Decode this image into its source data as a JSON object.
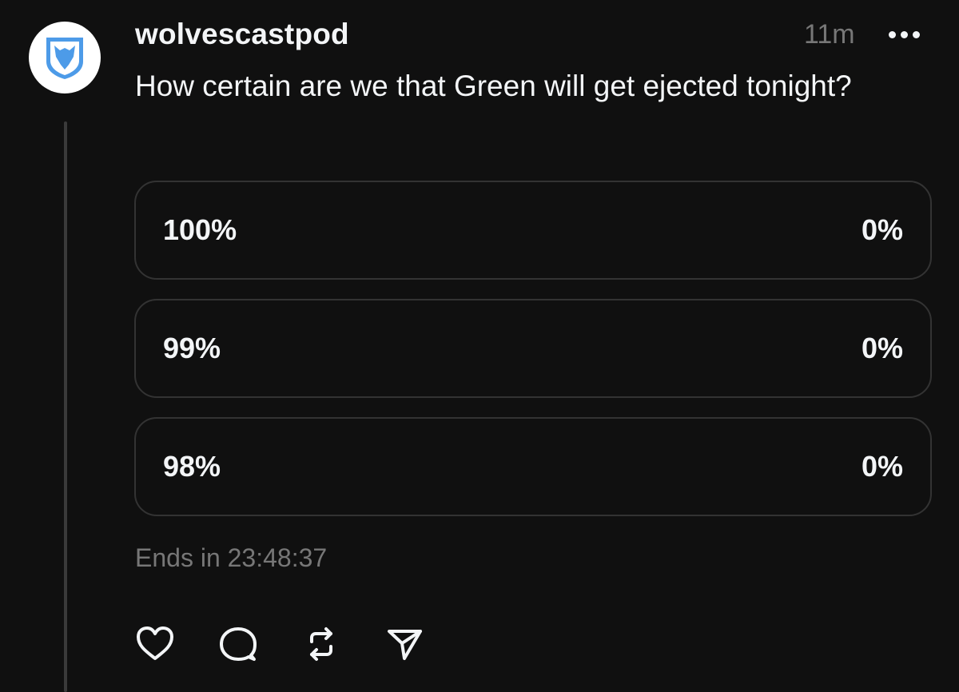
{
  "post": {
    "username": "wolvescastpod",
    "time": "11m",
    "text": "How certain are we that Green will get ejected tonight?",
    "avatar_icon": "wolf-shield-logo",
    "more_icon": "more-horizontal-icon"
  },
  "poll": {
    "options": [
      {
        "label": "100%",
        "result": "0%"
      },
      {
        "label": "99%",
        "result": "0%"
      },
      {
        "label": "98%",
        "result": "0%"
      }
    ],
    "ends_text": "Ends in 23:48:37"
  },
  "actions": {
    "like_icon": "heart-icon",
    "reply_icon": "comment-icon",
    "repost_icon": "repost-icon",
    "share_icon": "send-icon"
  },
  "colors": {
    "background": "#101010",
    "text": "#f3f5f7",
    "muted": "#777777",
    "border": "#333333",
    "logo_blue": "#4d9be8"
  }
}
